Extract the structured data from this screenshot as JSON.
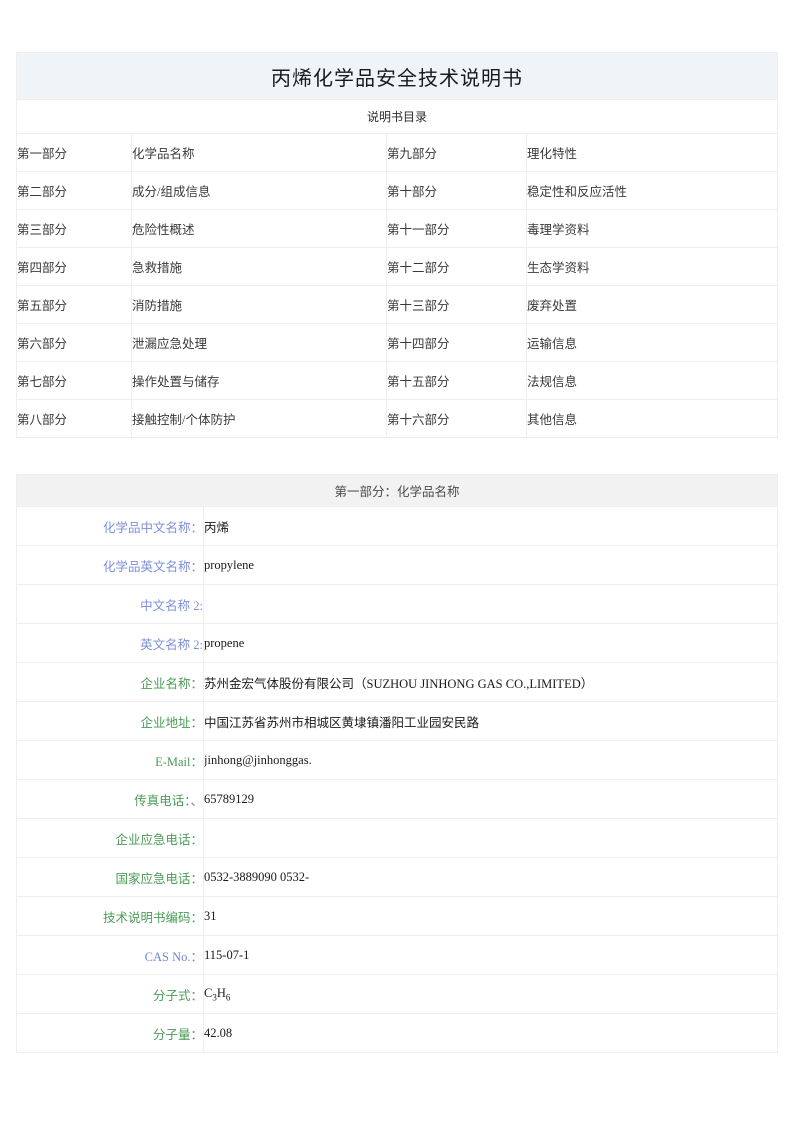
{
  "document": {
    "title": "丙烯化学品安全技术说明书",
    "subtitle": "说明书目录"
  },
  "toc": {
    "rows": [
      {
        "left_no": "第一部分",
        "left_title": "化学品名称",
        "right_no": "第九部分",
        "right_title": "理化特性"
      },
      {
        "left_no": "第二部分",
        "left_title": "成分/组成信息",
        "right_no": "第十部分",
        "right_title": "稳定性和反应活性"
      },
      {
        "left_no": "第三部分",
        "left_title": "危险性概述",
        "right_no": "第十一部分",
        "right_title": "毒理学资料"
      },
      {
        "left_no": "第四部分",
        "left_title": "急救措施",
        "right_no": "第十二部分",
        "right_title": "生态学资料"
      },
      {
        "left_no": "第五部分",
        "left_title": "消防措施",
        "right_no": "第十三部分",
        "right_title": "废弃处置"
      },
      {
        "left_no": "第六部分",
        "left_title": "泄漏应急处理",
        "right_no": "第十四部分",
        "right_title": "运输信息"
      },
      {
        "left_no": "第七部分",
        "left_title": "操作处置与储存",
        "right_no": "第十五部分",
        "right_title": "法规信息"
      },
      {
        "left_no": "第八部分",
        "left_title": "接触控制/个体防护",
        "right_no": "第十六部分",
        "right_title": "其他信息"
      }
    ]
  },
  "part1": {
    "heading": "第一部分：化学品名称",
    "fields": [
      {
        "label": "化学品中文名称：",
        "value": "丙烯",
        "label_color": "blue"
      },
      {
        "label": "化学品英文名称：",
        "value": "propylene",
        "label_color": "blue"
      },
      {
        "label": "中文名称 2:",
        "value": "",
        "label_color": "blue"
      },
      {
        "label": "英文名称 2:",
        "value": "propene",
        "label_color": "blue"
      },
      {
        "label": "企业名称：",
        "value": "苏州金宏气体股份有限公司（SUZHOU JINHONG GAS CO.,LIMITED）",
        "label_color": "green"
      },
      {
        "label": "企业地址：",
        "value": "中国江苏省苏州市相城区黄埭镇潘阳工业园安民路",
        "label_color": "green"
      },
      {
        "label": "E-Mail：",
        "value": "jinhong@jinhonggas.",
        "label_color": "green"
      },
      {
        "label": "传真电话：、",
        "value": "65789129",
        "label_color": "green"
      },
      {
        "label": "企业应急电话：",
        "value": "",
        "label_color": "green"
      },
      {
        "label": "国家应急电话：",
        "value": "0532-3889090   0532-",
        "label_color": "green"
      },
      {
        "label": "技术说明书编码：",
        "value": "31",
        "label_color": "green"
      },
      {
        "label": "CAS No.：",
        "value": "115-07-1",
        "label_color": "blue2"
      },
      {
        "label": "分子式：",
        "value": "C3H6",
        "value_html": "C<sub>3</sub>H<sub>6</sub>",
        "label_color": "green"
      },
      {
        "label": "分子量：",
        "value": "42.08",
        "label_color": "green"
      }
    ]
  },
  "colors": {
    "title_bg": "#eff4f8",
    "section_bg": "#f2f2f2",
    "border": "#eeeeee",
    "label_blue": "#7b8fdc",
    "label_green": "#4a9b56",
    "text": "#333333"
  }
}
